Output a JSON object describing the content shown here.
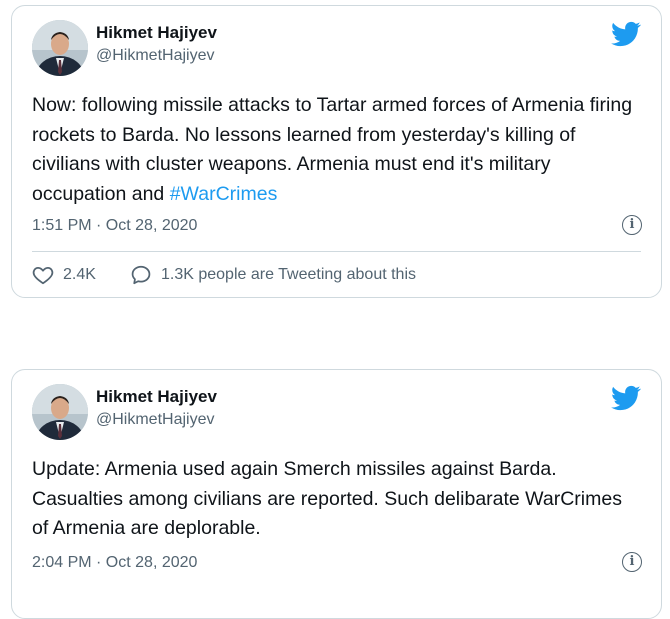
{
  "tweets": [
    {
      "author_name": "Hikmet Hajiyev",
      "author_handle": "@HikmetHajiyev",
      "text_before": "Now: following missile attacks to Tartar armed forces of Armenia firing rockets to Barda. No lessons learned from yesterday's killing of civilians with cluster weapons. Armenia must end it's military occupation and ",
      "hashtag": "#WarCrimes",
      "timestamp": "1:51 PM · Oct 28, 2020",
      "like_count": "2.4K",
      "conversation_text": "1.3K people are Tweeting about this"
    },
    {
      "author_name": "Hikmet Hajiyev",
      "author_handle": "@HikmetHajiyev",
      "text": "Update: Armenia used again Smerch missiles against Barda. Casualties among civilians are reported. Such delibarate WarCrimes of Armenia are deplorable.",
      "timestamp": "2:04 PM · Oct 28, 2020"
    }
  ],
  "colors": {
    "twitter_blue": "#1d9bf0",
    "text_primary": "#0f1419",
    "text_secondary": "#536471",
    "border": "#cfd9de"
  },
  "icons": {
    "logo": "twitter-bird-icon",
    "info": "info-icon",
    "like": "heart-icon",
    "reply": "speech-bubble-icon"
  }
}
